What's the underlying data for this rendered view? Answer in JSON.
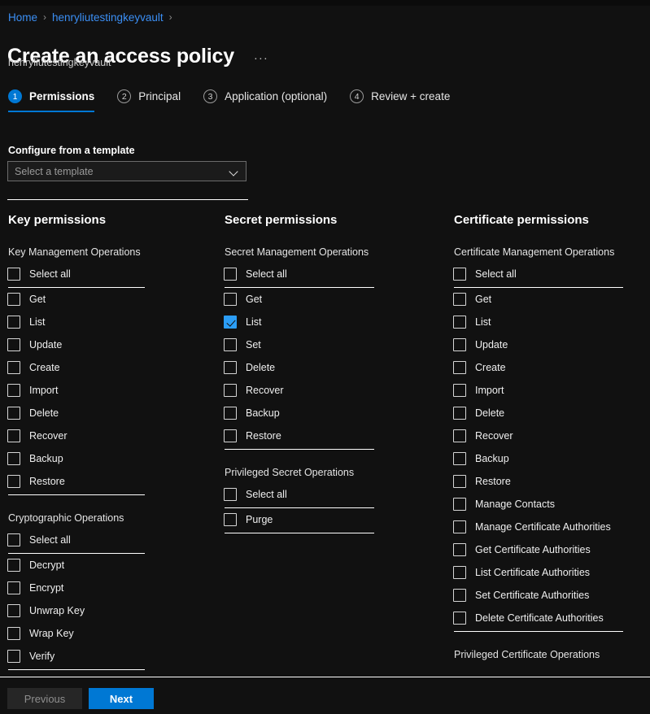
{
  "colors": {
    "background": "#111111",
    "accent": "#0078d4",
    "link": "#3b8ff5",
    "checkbox_checked": "#2b9df5",
    "rule": "#ffffff"
  },
  "breadcrumb": {
    "items": [
      {
        "label": "Home"
      },
      {
        "label": "henryliutestingkeyvault"
      }
    ],
    "separator": "›",
    "trailing_separator": "›"
  },
  "header": {
    "title": "Create an access policy",
    "more_menu": "···",
    "subtitle": "henryliutestingkeyvault"
  },
  "wizard": {
    "tabs": [
      {
        "number": "1",
        "label": "Permissions",
        "active": true
      },
      {
        "number": "2",
        "label": "Principal",
        "active": false
      },
      {
        "number": "3",
        "label": "Application (optional)",
        "active": false
      },
      {
        "number": "4",
        "label": "Review + create",
        "active": false
      }
    ]
  },
  "template": {
    "label": "Configure from a template",
    "placeholder": "Select a template",
    "value": ""
  },
  "columns": [
    {
      "title": "Key permissions",
      "groups": [
        {
          "title": "Key Management Operations",
          "select_all": {
            "label": "Select all",
            "checked": false
          },
          "items": [
            {
              "label": "Get",
              "checked": false
            },
            {
              "label": "List",
              "checked": false
            },
            {
              "label": "Update",
              "checked": false
            },
            {
              "label": "Create",
              "checked": false
            },
            {
              "label": "Import",
              "checked": false
            },
            {
              "label": "Delete",
              "checked": false
            },
            {
              "label": "Recover",
              "checked": false
            },
            {
              "label": "Backup",
              "checked": false
            },
            {
              "label": "Restore",
              "checked": false
            }
          ]
        },
        {
          "title": "Cryptographic Operations",
          "select_all": {
            "label": "Select all",
            "checked": false
          },
          "items": [
            {
              "label": "Decrypt",
              "checked": false
            },
            {
              "label": "Encrypt",
              "checked": false
            },
            {
              "label": "Unwrap Key",
              "checked": false
            },
            {
              "label": "Wrap Key",
              "checked": false
            },
            {
              "label": "Verify",
              "checked": false
            }
          ]
        }
      ]
    },
    {
      "title": "Secret permissions",
      "groups": [
        {
          "title": "Secret Management Operations",
          "select_all": {
            "label": "Select all",
            "checked": false
          },
          "items": [
            {
              "label": "Get",
              "checked": false
            },
            {
              "label": "List",
              "checked": true
            },
            {
              "label": "Set",
              "checked": false
            },
            {
              "label": "Delete",
              "checked": false
            },
            {
              "label": "Recover",
              "checked": false
            },
            {
              "label": "Backup",
              "checked": false
            },
            {
              "label": "Restore",
              "checked": false
            }
          ]
        },
        {
          "title": "Privileged Secret Operations",
          "select_all": {
            "label": "Select all",
            "checked": false
          },
          "items": [
            {
              "label": "Purge",
              "checked": false
            }
          ]
        }
      ]
    },
    {
      "title": "Certificate permissions",
      "groups": [
        {
          "title": "Certificate Management Operations",
          "select_all": {
            "label": "Select all",
            "checked": false
          },
          "items": [
            {
              "label": "Get",
              "checked": false
            },
            {
              "label": "List",
              "checked": false
            },
            {
              "label": "Update",
              "checked": false
            },
            {
              "label": "Create",
              "checked": false
            },
            {
              "label": "Import",
              "checked": false
            },
            {
              "label": "Delete",
              "checked": false
            },
            {
              "label": "Recover",
              "checked": false
            },
            {
              "label": "Backup",
              "checked": false
            },
            {
              "label": "Restore",
              "checked": false
            },
            {
              "label": "Manage Contacts",
              "checked": false
            },
            {
              "label": "Manage Certificate Authorities",
              "checked": false
            },
            {
              "label": "Get Certificate Authorities",
              "checked": false
            },
            {
              "label": "List Certificate Authorities",
              "checked": false
            },
            {
              "label": "Set Certificate Authorities",
              "checked": false
            },
            {
              "label": "Delete Certificate Authorities",
              "checked": false
            }
          ]
        },
        {
          "title": "Privileged Certificate Operations",
          "select_all": null,
          "items": []
        }
      ]
    }
  ],
  "footer": {
    "previous_label": "Previous",
    "next_label": "Next"
  }
}
